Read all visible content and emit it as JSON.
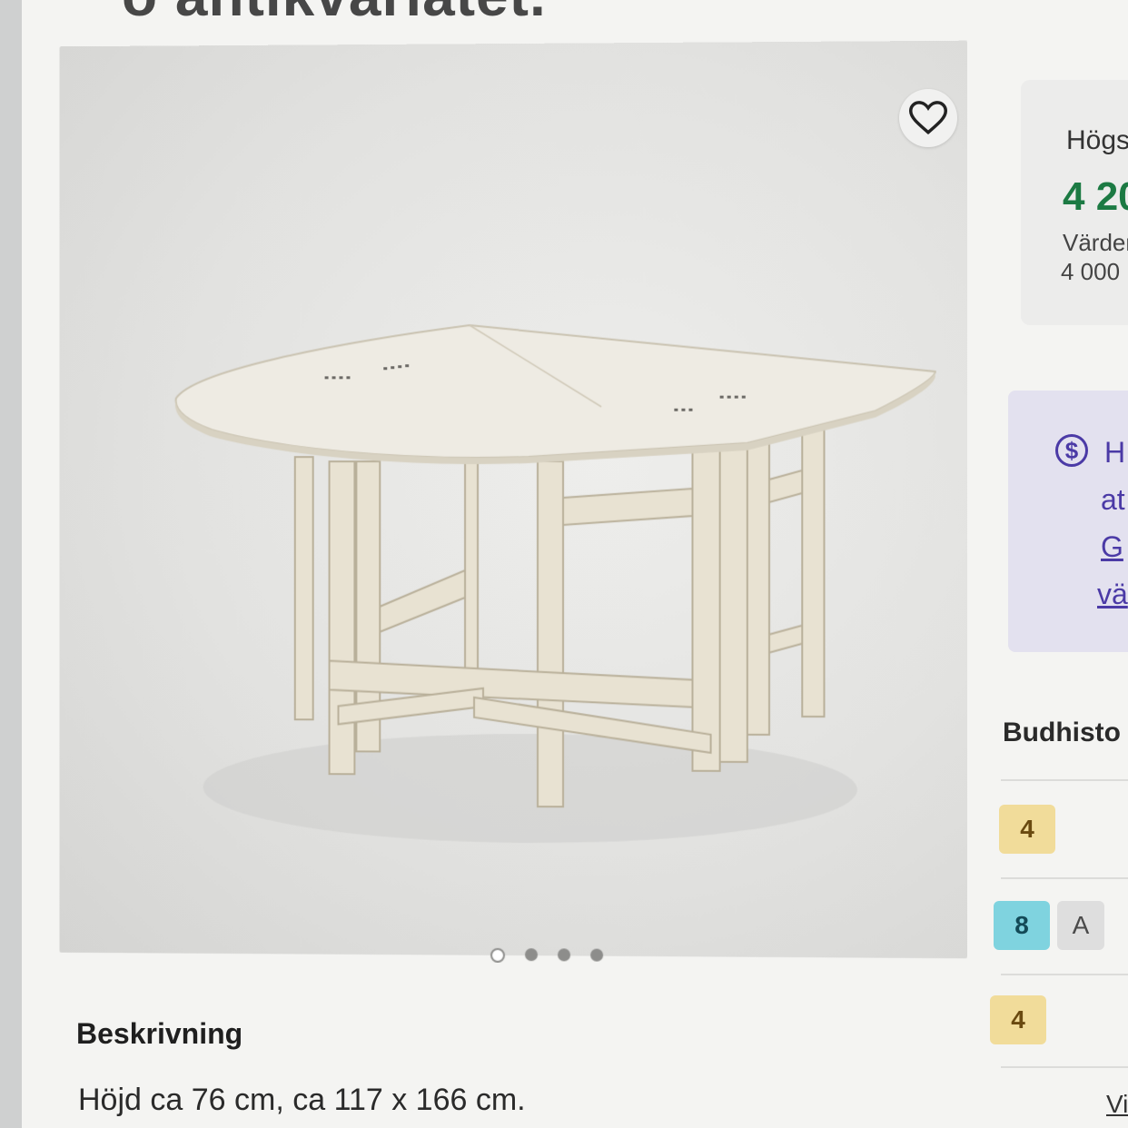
{
  "page": {
    "title_fragment": "ö antikvariatet."
  },
  "gallery": {
    "favorite_icon": "heart-outline-icon",
    "dots": 4,
    "active_dot": 0
  },
  "description": {
    "heading": "Beskrivning",
    "text": "Höjd ca 76 cm, ca 117 x 166 cm."
  },
  "bid_panel": {
    "label": "Högs",
    "current_bid": "4 20",
    "estimate_label": "Värder",
    "estimate_value": "4 000"
  },
  "fee_info": {
    "icon": "dollar-circle-icon",
    "line1": "H",
    "line2": "at",
    "line3_link": "G",
    "line4_link": "vä"
  },
  "bid_history": {
    "heading": "Budhisto",
    "rows": [
      {
        "badge": "4",
        "badge_color": "#f1dc9a",
        "extra": ""
      },
      {
        "badge": "8",
        "badge_color": "#7fd3df",
        "extra": "A"
      },
      {
        "badge": "4",
        "badge_color": "#f1dc9a",
        "extra": ""
      }
    ],
    "view_link": "Vi"
  },
  "colors": {
    "accent_purple": "#4b3aa6",
    "bid_green": "#1c7a43"
  }
}
